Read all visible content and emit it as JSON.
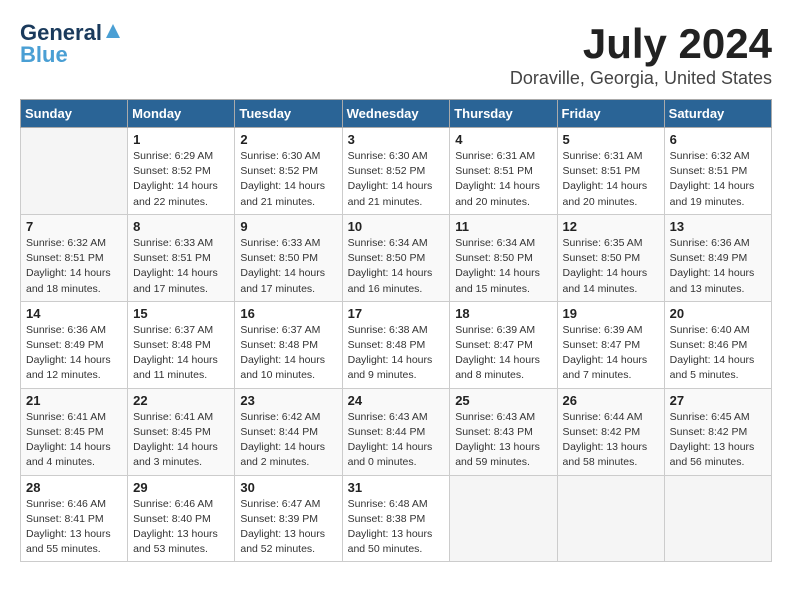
{
  "logo": {
    "line1": "General",
    "line2": "Blue"
  },
  "title": "July 2024",
  "subtitle": "Doraville, Georgia, United States",
  "days_of_week": [
    "Sunday",
    "Monday",
    "Tuesday",
    "Wednesday",
    "Thursday",
    "Friday",
    "Saturday"
  ],
  "weeks": [
    [
      {
        "day": "",
        "info": ""
      },
      {
        "day": "1",
        "info": "Sunrise: 6:29 AM\nSunset: 8:52 PM\nDaylight: 14 hours\nand 22 minutes."
      },
      {
        "day": "2",
        "info": "Sunrise: 6:30 AM\nSunset: 8:52 PM\nDaylight: 14 hours\nand 21 minutes."
      },
      {
        "day": "3",
        "info": "Sunrise: 6:30 AM\nSunset: 8:52 PM\nDaylight: 14 hours\nand 21 minutes."
      },
      {
        "day": "4",
        "info": "Sunrise: 6:31 AM\nSunset: 8:51 PM\nDaylight: 14 hours\nand 20 minutes."
      },
      {
        "day": "5",
        "info": "Sunrise: 6:31 AM\nSunset: 8:51 PM\nDaylight: 14 hours\nand 20 minutes."
      },
      {
        "day": "6",
        "info": "Sunrise: 6:32 AM\nSunset: 8:51 PM\nDaylight: 14 hours\nand 19 minutes."
      }
    ],
    [
      {
        "day": "7",
        "info": "Sunrise: 6:32 AM\nSunset: 8:51 PM\nDaylight: 14 hours\nand 18 minutes."
      },
      {
        "day": "8",
        "info": "Sunrise: 6:33 AM\nSunset: 8:51 PM\nDaylight: 14 hours\nand 17 minutes."
      },
      {
        "day": "9",
        "info": "Sunrise: 6:33 AM\nSunset: 8:50 PM\nDaylight: 14 hours\nand 17 minutes."
      },
      {
        "day": "10",
        "info": "Sunrise: 6:34 AM\nSunset: 8:50 PM\nDaylight: 14 hours\nand 16 minutes."
      },
      {
        "day": "11",
        "info": "Sunrise: 6:34 AM\nSunset: 8:50 PM\nDaylight: 14 hours\nand 15 minutes."
      },
      {
        "day": "12",
        "info": "Sunrise: 6:35 AM\nSunset: 8:50 PM\nDaylight: 14 hours\nand 14 minutes."
      },
      {
        "day": "13",
        "info": "Sunrise: 6:36 AM\nSunset: 8:49 PM\nDaylight: 14 hours\nand 13 minutes."
      }
    ],
    [
      {
        "day": "14",
        "info": "Sunrise: 6:36 AM\nSunset: 8:49 PM\nDaylight: 14 hours\nand 12 minutes."
      },
      {
        "day": "15",
        "info": "Sunrise: 6:37 AM\nSunset: 8:48 PM\nDaylight: 14 hours\nand 11 minutes."
      },
      {
        "day": "16",
        "info": "Sunrise: 6:37 AM\nSunset: 8:48 PM\nDaylight: 14 hours\nand 10 minutes."
      },
      {
        "day": "17",
        "info": "Sunrise: 6:38 AM\nSunset: 8:48 PM\nDaylight: 14 hours\nand 9 minutes."
      },
      {
        "day": "18",
        "info": "Sunrise: 6:39 AM\nSunset: 8:47 PM\nDaylight: 14 hours\nand 8 minutes."
      },
      {
        "day": "19",
        "info": "Sunrise: 6:39 AM\nSunset: 8:47 PM\nDaylight: 14 hours\nand 7 minutes."
      },
      {
        "day": "20",
        "info": "Sunrise: 6:40 AM\nSunset: 8:46 PM\nDaylight: 14 hours\nand 5 minutes."
      }
    ],
    [
      {
        "day": "21",
        "info": "Sunrise: 6:41 AM\nSunset: 8:45 PM\nDaylight: 14 hours\nand 4 minutes."
      },
      {
        "day": "22",
        "info": "Sunrise: 6:41 AM\nSunset: 8:45 PM\nDaylight: 14 hours\nand 3 minutes."
      },
      {
        "day": "23",
        "info": "Sunrise: 6:42 AM\nSunset: 8:44 PM\nDaylight: 14 hours\nand 2 minutes."
      },
      {
        "day": "24",
        "info": "Sunrise: 6:43 AM\nSunset: 8:44 PM\nDaylight: 14 hours\nand 0 minutes."
      },
      {
        "day": "25",
        "info": "Sunrise: 6:43 AM\nSunset: 8:43 PM\nDaylight: 13 hours\nand 59 minutes."
      },
      {
        "day": "26",
        "info": "Sunrise: 6:44 AM\nSunset: 8:42 PM\nDaylight: 13 hours\nand 58 minutes."
      },
      {
        "day": "27",
        "info": "Sunrise: 6:45 AM\nSunset: 8:42 PM\nDaylight: 13 hours\nand 56 minutes."
      }
    ],
    [
      {
        "day": "28",
        "info": "Sunrise: 6:46 AM\nSunset: 8:41 PM\nDaylight: 13 hours\nand 55 minutes."
      },
      {
        "day": "29",
        "info": "Sunrise: 6:46 AM\nSunset: 8:40 PM\nDaylight: 13 hours\nand 53 minutes."
      },
      {
        "day": "30",
        "info": "Sunrise: 6:47 AM\nSunset: 8:39 PM\nDaylight: 13 hours\nand 52 minutes."
      },
      {
        "day": "31",
        "info": "Sunrise: 6:48 AM\nSunset: 8:38 PM\nDaylight: 13 hours\nand 50 minutes."
      },
      {
        "day": "",
        "info": ""
      },
      {
        "day": "",
        "info": ""
      },
      {
        "day": "",
        "info": ""
      }
    ]
  ]
}
